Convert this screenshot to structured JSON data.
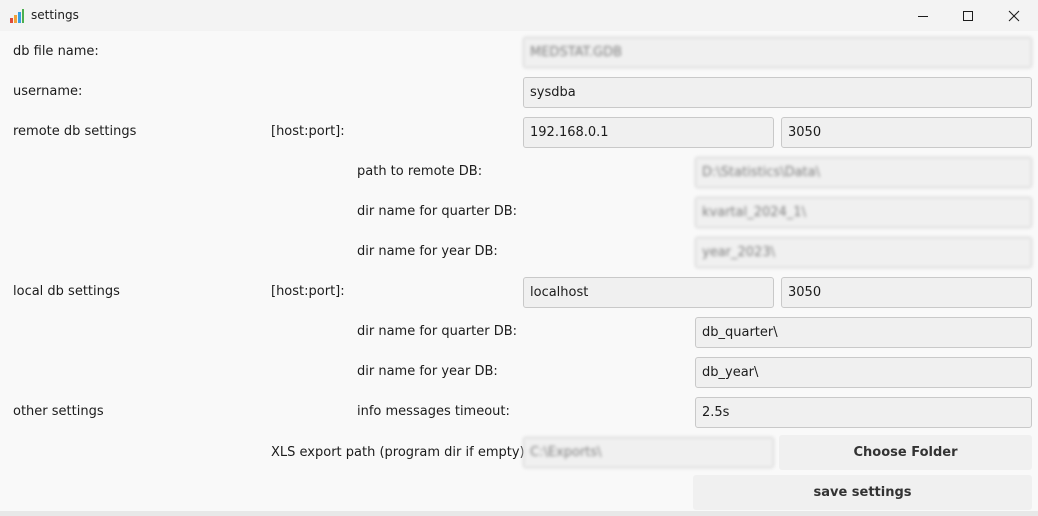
{
  "window": {
    "title": "settings",
    "icon": "bar-chart-icon",
    "controls": [
      "minimize-icon",
      "maximize-icon",
      "close-icon"
    ]
  },
  "colors": {
    "field_bg": "#f0f0f0",
    "field_border": "#c9c9c9",
    "window_bg": "#f9f9f9",
    "titlebar_bg": "#f3f3f3"
  },
  "labels": {
    "db_file_name": "db file name:",
    "username": "username:",
    "remote_db_settings": "remote db settings",
    "remote_host_port": "[host:port]:",
    "path_to_remote_db": "path to remote DB:",
    "remote_quarter_dir": "dir name for quarter DB:",
    "remote_year_dir": "dir name for year DB:",
    "local_db_settings": "local db settings",
    "local_host_port": "[host:port]:",
    "local_quarter_dir": "dir name for quarter DB:",
    "local_year_dir": "dir name for year DB:",
    "other_settings": "other settings",
    "info_timeout": "info messages timeout:",
    "xls_export_path": "XLS export path (program dir if empty):"
  },
  "fields": {
    "db_file_name": "MEDSTAT.GDB",
    "username": "sysdba",
    "remote_host": "192.168.0.1",
    "remote_port": "3050",
    "remote_db_path": "D:\\Statistics\\Data\\",
    "remote_quarter_dir": "kvartal_2024_1\\",
    "remote_year_dir": "year_2023\\",
    "local_host": "localhost",
    "local_port": "3050",
    "local_quarter_dir": "db_quarter\\",
    "local_year_dir": "db_year\\",
    "info_timeout": "2.5s",
    "xls_export_path": "C:\\Exports\\"
  },
  "buttons": {
    "choose_folder": "Choose Folder",
    "save_settings": "save settings"
  }
}
